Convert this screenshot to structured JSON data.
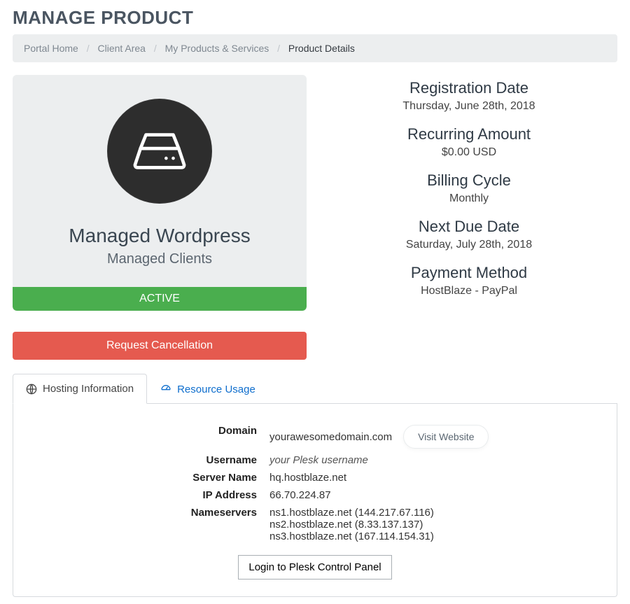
{
  "page_title": "MANAGE PRODUCT",
  "breadcrumb": {
    "items": [
      {
        "label": "Portal Home"
      },
      {
        "label": "Client Area"
      },
      {
        "label": "My Products & Services"
      },
      {
        "label": "Product Details"
      }
    ]
  },
  "product": {
    "name": "Managed Wordpress",
    "subtitle": "Managed Clients",
    "status": "ACTIVE",
    "icon": "hard-drive-icon"
  },
  "cancel_label": "Request Cancellation",
  "details": [
    {
      "key": "Registration Date",
      "value": "Thursday, June 28th, 2018"
    },
    {
      "key": "Recurring Amount",
      "value": "$0.00 USD"
    },
    {
      "key": "Billing Cycle",
      "value": "Monthly"
    },
    {
      "key": "Next Due Date",
      "value": "Saturday, July 28th, 2018"
    },
    {
      "key": "Payment Method",
      "value": "HostBlaze - PayPal"
    }
  ],
  "tabs": {
    "hosting": "Hosting Information",
    "resource": "Resource Usage"
  },
  "hosting": {
    "domain_label": "Domain",
    "domain_value": "yourawesomedomain.com",
    "visit_label": "Visit Website",
    "username_label": "Username",
    "username_value": "your Plesk username",
    "server_label": "Server Name",
    "server_value": "hq.hostblaze.net",
    "ip_label": "IP Address",
    "ip_value": "66.70.224.87",
    "ns_label": "Nameservers",
    "ns_values": [
      "ns1.hostblaze.net (144.217.67.116)",
      "ns2.hostblaze.net (8.33.137.137)",
      "ns3.hostblaze.net (167.114.154.31)"
    ],
    "login_label": "Login to Plesk Control Panel"
  }
}
